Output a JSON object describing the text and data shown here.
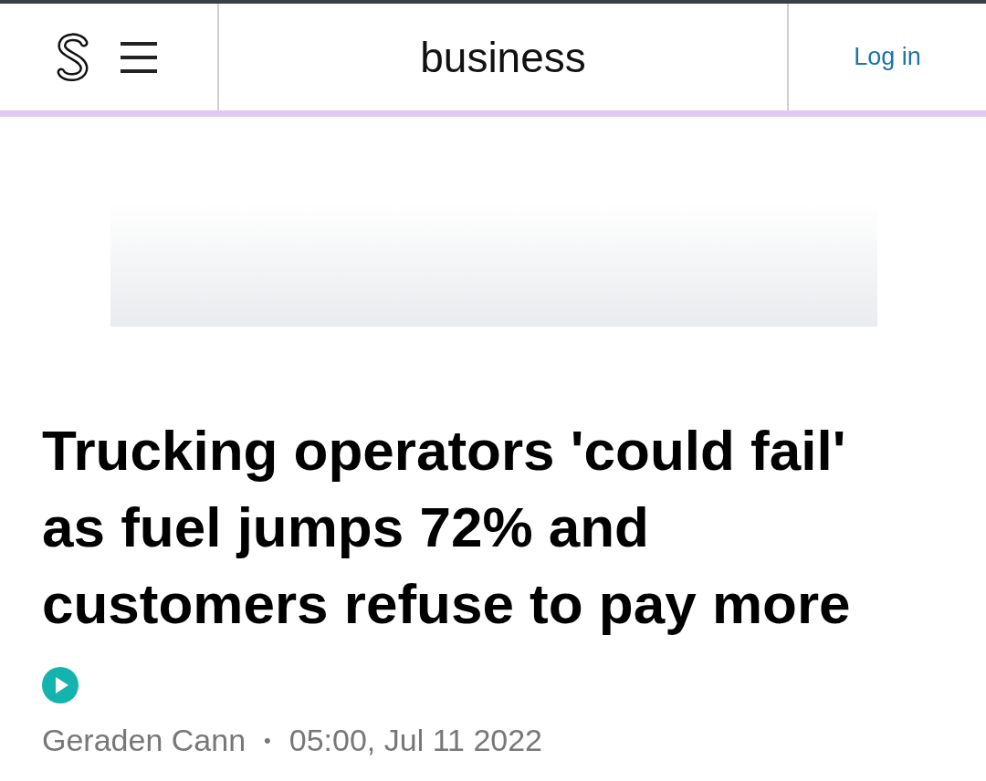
{
  "header": {
    "section": "business",
    "login": "Log in"
  },
  "article": {
    "headline": "Trucking operators 'could fail' as fuel jumps 72% and customers refuse to pay more",
    "has_audio": true,
    "author": "Geraden Cann",
    "separator": "•",
    "published": "05:00, Jul 11 2022"
  }
}
